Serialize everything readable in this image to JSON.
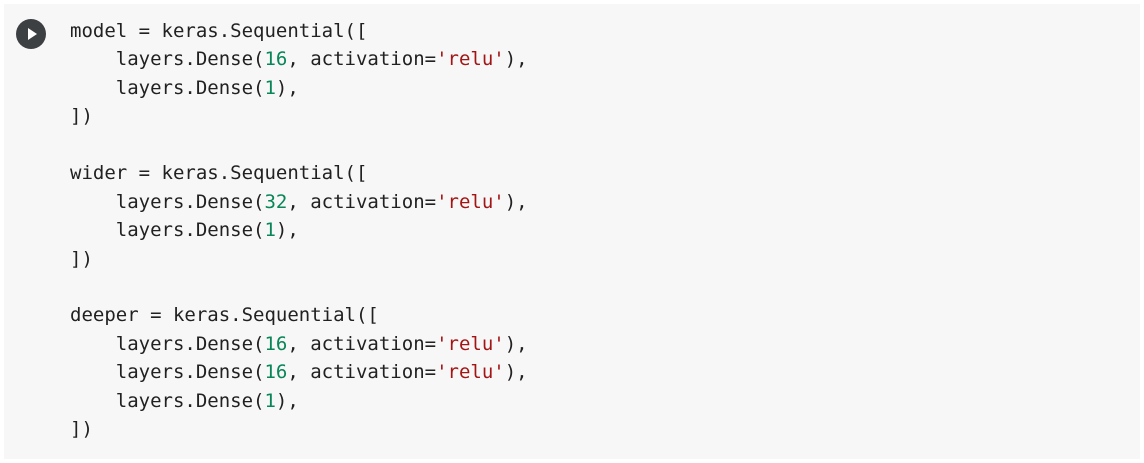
{
  "colors": {
    "cell_background": "#f7f7f7",
    "run_button": "#3c4043",
    "default_text": "#212121",
    "number": "#098658",
    "string": "#a31515"
  },
  "toolbar": {
    "run_icon": "play-icon"
  },
  "code": {
    "lines": [
      [
        {
          "text": "model = keras.Sequential([",
          "kind": "plain"
        }
      ],
      [
        {
          "text": "    layers.Dense(",
          "kind": "plain"
        },
        {
          "text": "16",
          "kind": "num"
        },
        {
          "text": ", activation=",
          "kind": "plain"
        },
        {
          "text": "'relu'",
          "kind": "str"
        },
        {
          "text": "),",
          "kind": "plain"
        }
      ],
      [
        {
          "text": "    layers.Dense(",
          "kind": "plain"
        },
        {
          "text": "1",
          "kind": "num"
        },
        {
          "text": "),",
          "kind": "plain"
        }
      ],
      [
        {
          "text": "])",
          "kind": "plain"
        }
      ],
      [],
      [
        {
          "text": "wider = keras.Sequential([",
          "kind": "plain"
        }
      ],
      [
        {
          "text": "    layers.Dense(",
          "kind": "plain"
        },
        {
          "text": "32",
          "kind": "num"
        },
        {
          "text": ", activation=",
          "kind": "plain"
        },
        {
          "text": "'relu'",
          "kind": "str"
        },
        {
          "text": "),",
          "kind": "plain"
        }
      ],
      [
        {
          "text": "    layers.Dense(",
          "kind": "plain"
        },
        {
          "text": "1",
          "kind": "num"
        },
        {
          "text": "),",
          "kind": "plain"
        }
      ],
      [
        {
          "text": "])",
          "kind": "plain"
        }
      ],
      [],
      [
        {
          "text": "deeper = keras.Sequential([",
          "kind": "plain"
        }
      ],
      [
        {
          "text": "    layers.Dense(",
          "kind": "plain"
        },
        {
          "text": "16",
          "kind": "num"
        },
        {
          "text": ", activation=",
          "kind": "plain"
        },
        {
          "text": "'relu'",
          "kind": "str"
        },
        {
          "text": "),",
          "kind": "plain"
        }
      ],
      [
        {
          "text": "    layers.Dense(",
          "kind": "plain"
        },
        {
          "text": "16",
          "kind": "num"
        },
        {
          "text": ", activation=",
          "kind": "plain"
        },
        {
          "text": "'relu'",
          "kind": "str"
        },
        {
          "text": "),",
          "kind": "plain"
        }
      ],
      [
        {
          "text": "    layers.Dense(",
          "kind": "plain"
        },
        {
          "text": "1",
          "kind": "num"
        },
        {
          "text": "),",
          "kind": "plain"
        }
      ],
      [
        {
          "text": "])",
          "kind": "plain"
        }
      ]
    ]
  }
}
